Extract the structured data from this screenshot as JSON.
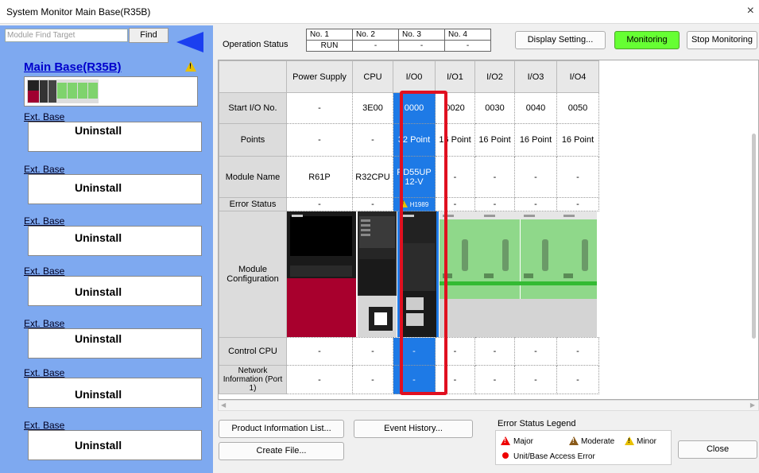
{
  "window": {
    "title": "System Monitor Main Base(R35B)",
    "close_glyph": "×"
  },
  "left": {
    "find_placeholder": "Module Find Target",
    "find_label": "Find",
    "main_base_label": "Main Base(R35B)",
    "ext_bases": [
      {
        "label": "Ext. Base",
        "status": "Uninstall"
      },
      {
        "label": "Ext. Base",
        "status": "Uninstall"
      },
      {
        "label": "Ext. Base",
        "status": "Uninstall"
      },
      {
        "label": "Ext. Base",
        "status": "Uninstall"
      },
      {
        "label": "Ext. Base",
        "status": "Uninstall"
      },
      {
        "label": "Ext. Base",
        "status": "Uninstall"
      },
      {
        "label": "Ext. Base",
        "status": "Uninstall"
      }
    ]
  },
  "top": {
    "operation_status_label": "Operation Status",
    "cpu_numbers": [
      "No. 1",
      "No. 2",
      "No. 3",
      "No. 4"
    ],
    "cpu_states": [
      "RUN",
      "-",
      "-",
      "-"
    ],
    "display_setting_label": "Display Setting...",
    "monitoring_label": "Monitoring",
    "stop_monitoring_label": "Stop Monitoring"
  },
  "grid": {
    "columns": [
      "Power Supply",
      "CPU",
      "I/O0",
      "I/O1",
      "I/O2",
      "I/O3",
      "I/O4"
    ],
    "rows": {
      "start_io": {
        "label": "Start I/O No.",
        "values": [
          "-",
          "3E00",
          "0000",
          "0020",
          "0030",
          "0040",
          "0050"
        ]
      },
      "points": {
        "label": "Points",
        "values": [
          "-",
          "-",
          "32 Point",
          "16 Point",
          "16 Point",
          "16 Point",
          "16 Point"
        ]
      },
      "module_name": {
        "label": "Module Name",
        "values": [
          "R61P",
          "R32CPU",
          "RD55UP\n12-V",
          "-",
          "-",
          "-",
          "-"
        ]
      },
      "error_status": {
        "label": "Error Status",
        "values": [
          "-",
          "-",
          "H1989",
          "-",
          "-",
          "-",
          "-"
        ]
      },
      "module_config": {
        "label": "Module Configuration"
      },
      "control_cpu": {
        "label": "Control CPU",
        "values": [
          "-",
          "-",
          "-",
          "-",
          "-",
          "-",
          "-"
        ]
      },
      "network_info": {
        "label": "Network Information (Port 1)",
        "values": [
          "-",
          "-",
          "-",
          "-",
          "-",
          "-",
          "-"
        ]
      }
    }
  },
  "bottom": {
    "product_info_label": "Product Information List...",
    "event_history_label": "Event History...",
    "create_file_label": "Create File...",
    "close_label": "Close",
    "legend_title": "Error Status Legend",
    "legend_major": "Major",
    "legend_moderate": "Moderate",
    "legend_minor": "Minor",
    "legend_access": "Unit/Base Access Error"
  },
  "colors": {
    "left_panel": "#7ea9f0",
    "selected_column": "#1e7ae6",
    "selection_outline": "#e01020",
    "monitoring_green": "#66ff33",
    "io_module_green": "#8fd88a"
  }
}
